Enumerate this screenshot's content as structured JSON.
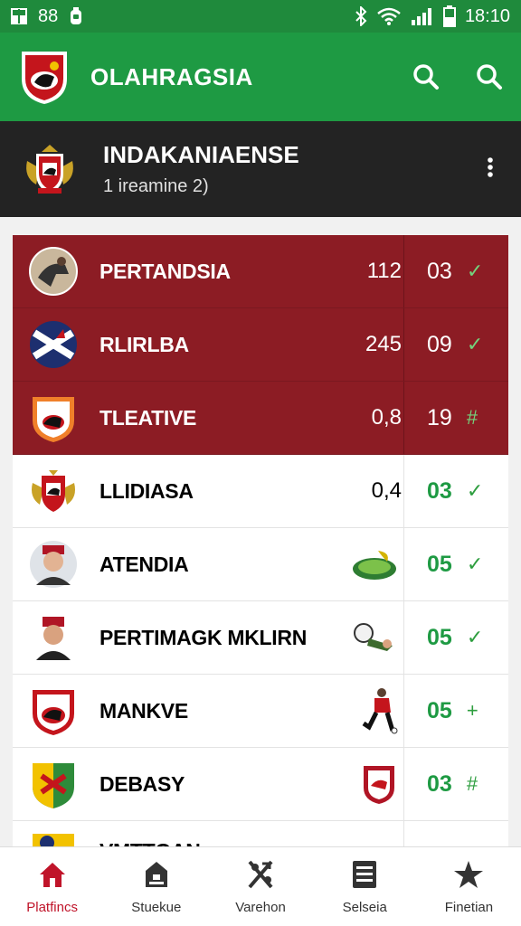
{
  "statusbar": {
    "left_text": "88",
    "time": "18:10"
  },
  "appbar": {
    "title": "OLAHRAGSIA",
    "icons": [
      "search-icon",
      "search-icon"
    ]
  },
  "subbar": {
    "name": "INDAKANIAENSE",
    "subtitle": "1 ireamine 2)"
  },
  "rows": [
    {
      "name": "PERTANDSIA",
      "value": "112",
      "score": "03",
      "mark": "✓",
      "highlight": true
    },
    {
      "name": "RLIRLBA",
      "value": "245",
      "score": "09",
      "mark": "✓",
      "highlight": true
    },
    {
      "name": "TLEATIVE",
      "value": "0,8",
      "score": "19",
      "mark": "#",
      "highlight": true
    },
    {
      "name": "LLIDIASA",
      "value": "0,4",
      "score": "03",
      "mark": "✓",
      "highlight": false
    },
    {
      "name": "ATENDIA",
      "value_icon": "stadium-icon",
      "score": "05",
      "mark": "✓",
      "highlight": false
    },
    {
      "name": "PERTIMAGK MKLIRN",
      "value_icon": "goalkeeper-icon",
      "score": "05",
      "mark": "✓",
      "highlight": false
    },
    {
      "name": "MANKVE",
      "value_icon": "player-icon",
      "score": "05",
      "mark": "+",
      "highlight": false
    },
    {
      "name": "DEBASY",
      "value_icon": "jersey-icon",
      "score": "03",
      "mark": "#",
      "highlight": false
    }
  ],
  "partial_row": {
    "name": "VMTTGAN"
  },
  "bottomnav": [
    {
      "label": "Platfincs",
      "icon": "home-icon",
      "active": true
    },
    {
      "label": "Stuekue",
      "icon": "shop-icon",
      "active": false
    },
    {
      "label": "Varehon",
      "icon": "tactics-icon",
      "active": false
    },
    {
      "label": "Selseia",
      "icon": "list-icon",
      "active": false
    },
    {
      "label": "Finetian",
      "icon": "star-icon",
      "active": false
    }
  ],
  "colors": {
    "green": "#1e9a43",
    "dark": "#232323",
    "maroon": "#8c1c24",
    "active_nav": "#c0142a"
  }
}
